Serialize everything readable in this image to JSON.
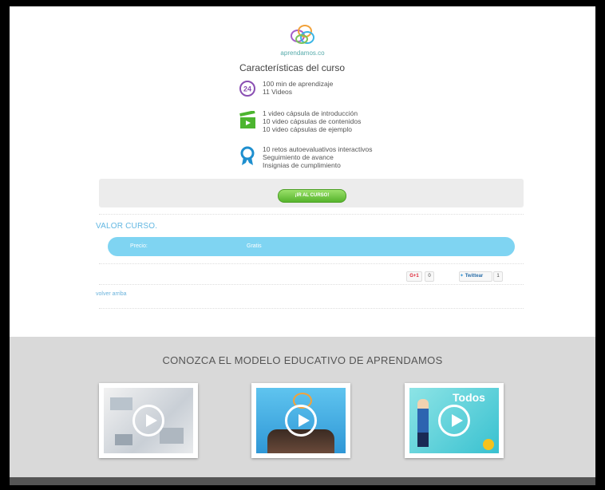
{
  "logo": {
    "text": "aprendamos.co"
  },
  "course": {
    "title": "Características del curso",
    "badge_24": "24",
    "group1": [
      "100 min de aprendizaje",
      "11 Videos"
    ],
    "group2": [
      "1  video cápsula de introducción",
      "10 video cápsulas de contenidos",
      "10  video cápsulas de ejemplo"
    ],
    "group3": [
      "10 retos autoevaluativos interactivos",
      "Seguimiento de avance",
      "Insignias de cumplimiento"
    ]
  },
  "cta": {
    "label": "¡IR AL CURSO!"
  },
  "valor": {
    "heading": "VALOR CURSO.",
    "price_label": "Precio:",
    "price_value": "Gratis"
  },
  "social": {
    "gplus": "G+1",
    "gplus_count": "0",
    "twitter": "Twittear",
    "twitter_count": "1"
  },
  "volver": "volver arriba",
  "modelo": {
    "heading": "CONOZCA EL MODELO EDUCATIVO DE APRENDAMOS"
  },
  "videos": [
    {
      "name": "video-1"
    },
    {
      "name": "video-2"
    },
    {
      "name": "video-3",
      "overlay_text": "Todos"
    }
  ],
  "colors": {
    "accent_blue": "#62b7e2",
    "green_button": "#56b42c",
    "purple": "#8a4fb3"
  }
}
